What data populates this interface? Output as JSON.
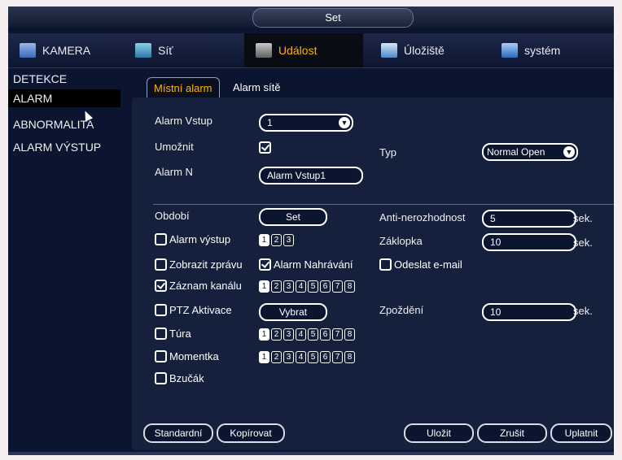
{
  "window": {
    "title": "Set"
  },
  "nav": {
    "tabs": [
      {
        "label": "KAMERA",
        "icon": "camera-icon"
      },
      {
        "label": "Síť",
        "icon": "network-icon"
      },
      {
        "label": "Událost",
        "icon": "event-icon",
        "active": true
      },
      {
        "label": "Úložiště",
        "icon": "storage-icon"
      },
      {
        "label": "systém",
        "icon": "system-icon"
      }
    ]
  },
  "sidebar": {
    "items": [
      {
        "label": "DETEKCE"
      },
      {
        "label": "ALARM",
        "active": true
      },
      {
        "label": "ABNORMALITA"
      },
      {
        "label": "ALARM VÝSTUP"
      }
    ]
  },
  "subtabs": [
    {
      "label": "Místní alarm",
      "active": true
    },
    {
      "label": "Alarm sítě"
    }
  ],
  "form": {
    "alarm_input_label": "Alarm Vstup",
    "alarm_input_value": "1",
    "enable_label": "Umožnit",
    "enable_checked": true,
    "type_label": "Typ",
    "type_value": "Normal Open",
    "alarm_name_label": "Alarm N",
    "alarm_name_value": "Alarm Vstup1",
    "period_label": "Období",
    "period_button": "Set",
    "anti_dither_label": "Anti-nerozhodnost",
    "anti_dither_value": "5",
    "unit_sec": "sek.",
    "alarm_output_label": "Alarm výstup",
    "alarm_output_channels": [
      "1",
      "2",
      "3"
    ],
    "latch_label": "Záklopka",
    "latch_value": "10",
    "show_message_label": "Zobrazit zprávu",
    "alarm_record_label": "Alarm Nahrávání",
    "alarm_record_checked": true,
    "send_email_label": "Odeslat e-mail",
    "record_channel_label": "Záznam kanálu",
    "record_channel_checked": true,
    "channels_8": [
      "1",
      "2",
      "3",
      "4",
      "5",
      "6",
      "7",
      "8"
    ],
    "ptz_label": "PTZ Aktivace",
    "ptz_button": "Vybrat",
    "delay_label": "Zpoždění",
    "delay_value": "10",
    "tour_label": "Túra",
    "snapshot_label": "Momentka",
    "buzzer_label": "Bzučák"
  },
  "buttons": {
    "default": "Standardní",
    "copy": "Kopírovat",
    "save": "Uložit",
    "cancel": "Zrušit",
    "apply": "Uplatnit"
  },
  "colors": {
    "accent": "#ffb400",
    "background": "#0b1530",
    "panel": "#15203c"
  }
}
